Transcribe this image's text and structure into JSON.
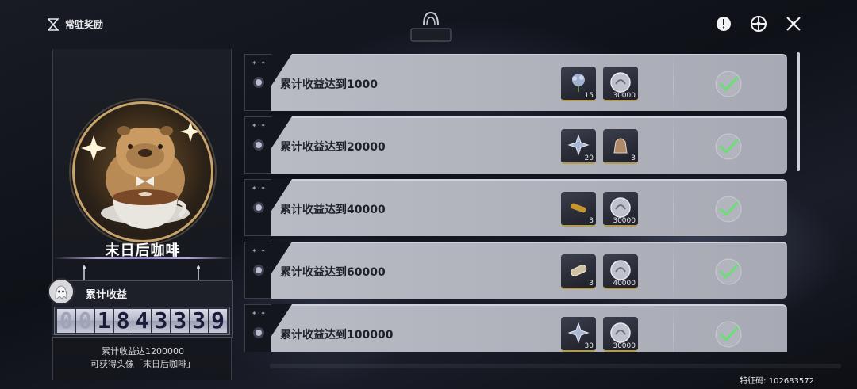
{
  "header": {
    "title": "常驻奖励",
    "icons": [
      "info-icon",
      "target-icon",
      "close-icon"
    ]
  },
  "left_panel": {
    "avatar_name": "末日后咖啡",
    "earnings_label": "累计收益",
    "counter_digits": [
      "0",
      "0",
      "1",
      "8",
      "4",
      "3",
      "3",
      "3",
      "9"
    ],
    "hint_line1": "累计收益达1200000",
    "hint_line2": "可获得头像「末日后咖啡」"
  },
  "rewards": [
    {
      "label": "累计收益达到1000",
      "items": [
        {
          "icon": "flower-icon",
          "qty": "15"
        },
        {
          "icon": "coin-icon",
          "qty": "30000"
        }
      ],
      "claimed": true
    },
    {
      "label": "累计收益达到20000",
      "items": [
        {
          "icon": "star-crystal-icon",
          "qty": "20"
        },
        {
          "icon": "bag-icon",
          "qty": "3"
        }
      ],
      "claimed": true
    },
    {
      "label": "累计收益达到40000",
      "items": [
        {
          "icon": "scroll-icon",
          "qty": "3"
        },
        {
          "icon": "coin-icon",
          "qty": "30000"
        }
      ],
      "claimed": true
    },
    {
      "label": "累计收益达到60000",
      "items": [
        {
          "icon": "cylinder-icon",
          "qty": "3"
        },
        {
          "icon": "coin-icon",
          "qty": "40000"
        }
      ],
      "claimed": true
    },
    {
      "label": "累计收益达到100000",
      "items": [
        {
          "icon": "star-crystal-icon",
          "qty": "30"
        },
        {
          "icon": "coin-icon",
          "qty": "30000"
        }
      ],
      "claimed": true
    }
  ],
  "footer": {
    "feature_code": "特征码: 102683572"
  },
  "colors": {
    "accent_gold": "#c9a46a",
    "check_green": "#6fdc7a",
    "card_bg": "#b9bbc4"
  }
}
